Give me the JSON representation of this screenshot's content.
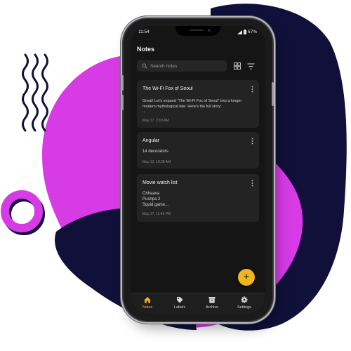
{
  "status_bar": {
    "time": "11:54",
    "battery": "67%"
  },
  "app": {
    "title": "Notes"
  },
  "search": {
    "placeholder": "Search notes"
  },
  "notes": [
    {
      "title": "The Wi-Fi Fox of Seoul",
      "body": "Great! Let's expand \"The Wi-Fi Fox of Seoul\" into a longer modern mythological tale. Here's the full story:\n...",
      "date": "May 17, 2:18 AM"
    },
    {
      "title": "Angular",
      "body": "14 decorators",
      "date": "May 12, 10:39 AM"
    },
    {
      "title": "Movie watch list",
      "body": "Chhaava\nPushpa 2\nSquid game...",
      "date": "May 17, 11:46 PM"
    }
  ],
  "fab": {
    "icon": "plus-icon"
  },
  "nav": [
    {
      "label": "Notes",
      "icon": "home-icon",
      "active": true
    },
    {
      "label": "Labels",
      "icon": "tag-icon",
      "active": false
    },
    {
      "label": "Archive",
      "icon": "archive-icon",
      "active": false
    },
    {
      "label": "Settings",
      "icon": "gear-icon",
      "active": false
    }
  ],
  "colors": {
    "accent": "#f3b51c",
    "magenta": "#d63be6",
    "navy": "#10103a",
    "background": "#151515",
    "card": "#232323"
  }
}
